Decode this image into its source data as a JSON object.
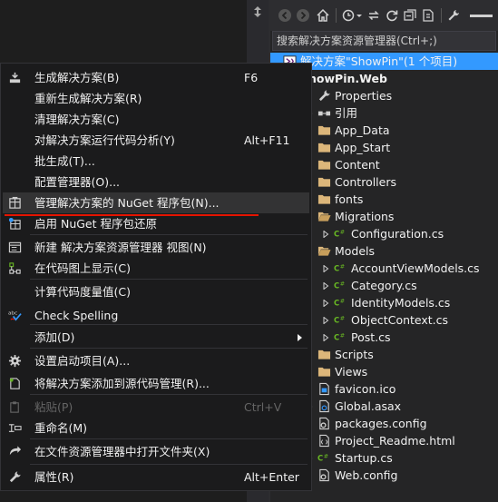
{
  "colors": {
    "accent_selection": "#3399ff",
    "underline_red": "#e51400",
    "menu_bg": "#1b1b1c",
    "panel_bg": "#252526"
  },
  "explorer": {
    "search_placeholder": "搜索解决方案资源管理器(Ctrl+;)",
    "toolbar_icons": [
      "back-icon",
      "forward-icon",
      "home-icon",
      "history-icon",
      "dropdown-icon",
      "sync-icon",
      "refresh-icon",
      "collapse-all-icon",
      "show-all-files-icon",
      "properties-wrench-icon",
      "preview-icon"
    ],
    "tree": [
      {
        "label": "解决方案\"ShowPin\"(1 个项目)",
        "icon": "solution-icon",
        "selected": true
      },
      {
        "label": "ShowPin.Web",
        "icon": "web-project-icon",
        "bold": true
      },
      {
        "label": "Properties",
        "icon": "wrench-icon"
      },
      {
        "label": "引用",
        "icon": "references-icon"
      },
      {
        "label": "App_Data",
        "icon": "folder-icon"
      },
      {
        "label": "App_Start",
        "icon": "folder-icon"
      },
      {
        "label": "Content",
        "icon": "folder-icon"
      },
      {
        "label": "Controllers",
        "icon": "folder-icon"
      },
      {
        "label": "fonts",
        "icon": "folder-icon"
      },
      {
        "label": "Migrations",
        "icon": "folder-open-icon"
      },
      {
        "label": "Configuration.cs",
        "icon": "csharp-file-icon"
      },
      {
        "label": "Models",
        "icon": "folder-open-icon"
      },
      {
        "label": "AccountViewModels.cs",
        "icon": "csharp-file-icon"
      },
      {
        "label": "Category.cs",
        "icon": "csharp-file-icon"
      },
      {
        "label": "IdentityModels.cs",
        "icon": "csharp-file-icon"
      },
      {
        "label": "ObjectContext.cs",
        "icon": "csharp-file-icon"
      },
      {
        "label": "Post.cs",
        "icon": "csharp-file-icon"
      },
      {
        "label": "Scripts",
        "icon": "folder-icon"
      },
      {
        "label": "Views",
        "icon": "folder-icon"
      },
      {
        "label": "favicon.ico",
        "icon": "ico-file-icon"
      },
      {
        "label": "Global.asax",
        "icon": "asax-file-icon"
      },
      {
        "label": "packages.config",
        "icon": "config-file-icon"
      },
      {
        "label": "Project_Readme.html",
        "icon": "html-file-icon"
      },
      {
        "label": "Startup.cs",
        "icon": "csharp-file-icon"
      },
      {
        "label": "Web.config",
        "icon": "config-file-icon"
      }
    ]
  },
  "context_menu": {
    "items": [
      {
        "label": "生成解决方案(B)",
        "shortcut": "F6",
        "icon": "build-icon"
      },
      {
        "label": "重新生成解决方案(R)",
        "shortcut": ""
      },
      {
        "label": "清理解决方案(C)",
        "shortcut": ""
      },
      {
        "label": "对解决方案运行代码分析(Y)",
        "shortcut": "Alt+F11"
      },
      {
        "label": "批生成(T)...",
        "shortcut": ""
      },
      {
        "label": "配置管理器(O)...",
        "shortcut": ""
      },
      {
        "label": "管理解决方案的 NuGet 程序包(N)...",
        "shortcut": "",
        "icon": "nuget-icon",
        "highlighted": true
      },
      {
        "label": "启用 NuGet 程序包还原",
        "shortcut": "",
        "icon": "nuget-restore-icon"
      },
      {
        "label": "新建 解决方案资源管理器 视图(N)",
        "shortcut": "",
        "icon": "new-view-icon"
      },
      {
        "label": "在代码图上显示(C)",
        "shortcut": "",
        "icon": "code-map-icon"
      },
      {
        "label": "计算代码度量值(C)",
        "shortcut": ""
      },
      {
        "label": "Check Spelling",
        "shortcut": "",
        "icon": "spell-check-icon"
      },
      {
        "label": "添加(D)",
        "shortcut": "",
        "submenu": true
      },
      {
        "label": "设置启动项目(A)...",
        "shortcut": "",
        "icon": "gear-icon"
      },
      {
        "label": "将解决方案添加到源代码管理(R)...",
        "shortcut": "",
        "icon": "source-control-icon"
      },
      {
        "label": "粘贴(P)",
        "shortcut": "Ctrl+V",
        "icon": "paste-icon",
        "disabled": true
      },
      {
        "label": "重命名(M)",
        "shortcut": "",
        "icon": "rename-icon"
      },
      {
        "label": "在文件资源管理器中打开文件夹(X)",
        "shortcut": "",
        "icon": "open-folder-icon"
      },
      {
        "label": "属性(R)",
        "shortcut": "Alt+Enter",
        "icon": "wrench-icon"
      }
    ]
  }
}
